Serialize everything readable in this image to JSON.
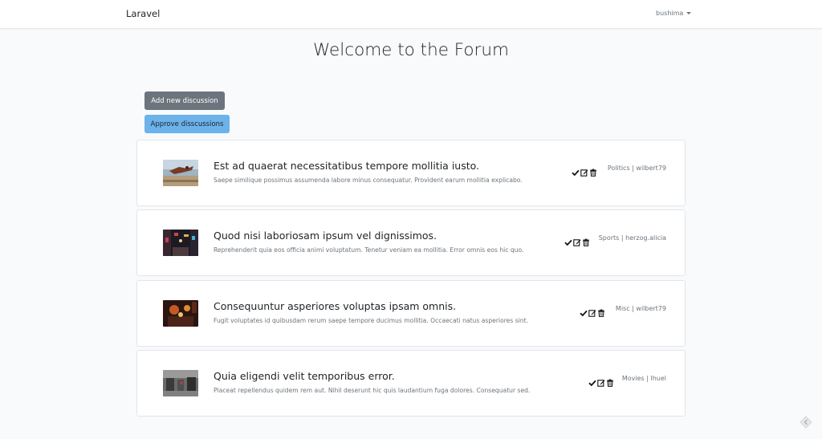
{
  "navbar": {
    "brand": "Laravel",
    "user": "bushima"
  },
  "page": {
    "title": "Welcome to the Forum"
  },
  "buttons": {
    "add_label": "Add new discussion",
    "approve_label": "Approve disscussions"
  },
  "discussions": [
    {
      "title": "Est ad quaerat necessitatibus tempore mollitia iusto.",
      "excerpt": "Saepe similique possimus assumenda labore minus consequatur. Provident earum mollitia explicabo.",
      "category": "Politics",
      "author": "wilbert79",
      "meta": "Politics | wilbert79",
      "thumbnail": "skier-in-air-photo"
    },
    {
      "title": "Quod nisi laboriosam ipsum vel dignissimos.",
      "excerpt": "Reprehenderit quia eos officia animi voluptatum. Tenetur veniam ea mollitia. Error omnis eos hic quo.",
      "category": "Sports",
      "author": "herzog.alicia",
      "meta": "Sports | herzog.alicia",
      "thumbnail": "city-street-night-photo"
    },
    {
      "title": "Consequuntur asperiores voluptas ipsam omnis.",
      "excerpt": "Fugit voluptates id quibusdam rerum saepe tempore ducimus mollitia. Occaecati natus asperiores sint.",
      "category": "Misc",
      "author": "wilbert79",
      "meta": "Misc | wilbert79",
      "thumbnail": "warm-lit-interior-photo"
    },
    {
      "title": "Quia eligendi velit temporibus error.",
      "excerpt": "Placeat repellendus quidem rem aut. Nihil deserunt hic quis laudantium fuga dolores. Consequatur sed.",
      "category": "Movies",
      "author": "lhuel",
      "meta": "Movies | lhuel",
      "thumbnail": "street-scene-photo"
    }
  ],
  "icons": {
    "approve": "check-icon",
    "edit": "edit-icon",
    "delete": "trash-icon",
    "corner": "debugbar-icon"
  },
  "colors": {
    "background": "#f8fafc",
    "secondary_button": "#6c757d",
    "info_button": "#6cb2eb",
    "muted_text": "#6c757d"
  }
}
